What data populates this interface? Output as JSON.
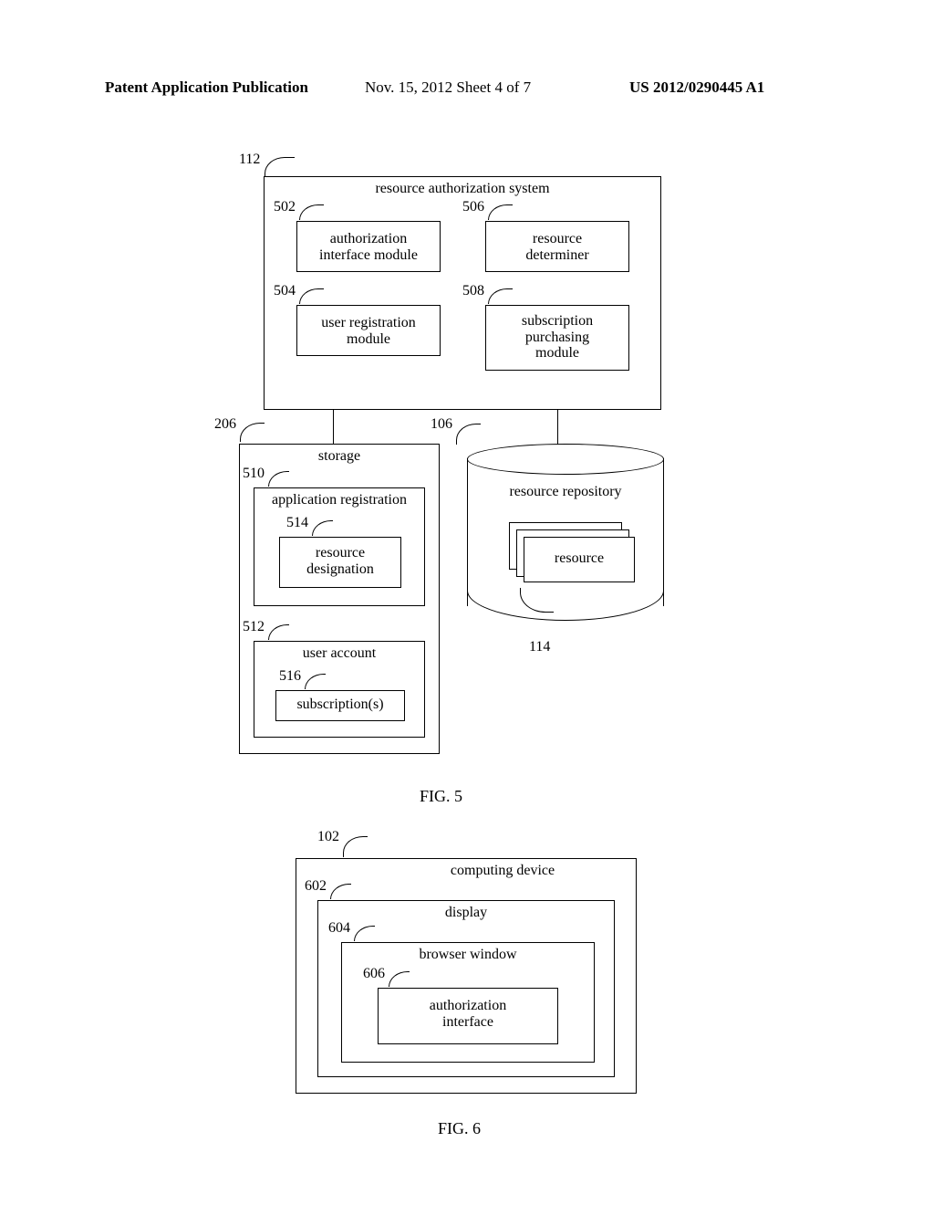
{
  "header": {
    "left": "Patent Application Publication",
    "mid": "Nov. 15, 2012  Sheet 4 of 7",
    "right": "US 2012/0290445 A1"
  },
  "fig5": {
    "caption": "FIG. 5",
    "refs": {
      "r112": "112",
      "r502": "502",
      "r506": "506",
      "r504": "504",
      "r508": "508",
      "r206": "206",
      "r106": "106",
      "r510": "510",
      "r514": "514",
      "r512": "512",
      "r516": "516",
      "r114": "114"
    },
    "boxes": {
      "ras": "resource authorization system",
      "aim": "authorization\ninterface module",
      "rd": "resource\ndeterminer",
      "urm": "user registration\nmodule",
      "spm": "subscription\npurchasing\nmodule",
      "storage": "storage",
      "appreg": "application registration",
      "resdes": "resource\ndesignation",
      "useracct": "user account",
      "subs": "subscription(s)",
      "repo": "resource repository",
      "resource": "resource"
    }
  },
  "fig6": {
    "caption": "FIG. 6",
    "refs": {
      "r102": "102",
      "r602": "602",
      "r604": "604",
      "r606": "606"
    },
    "boxes": {
      "cd": "computing device",
      "disp": "display",
      "bw": "browser window",
      "ai": "authorization\ninterface"
    }
  }
}
